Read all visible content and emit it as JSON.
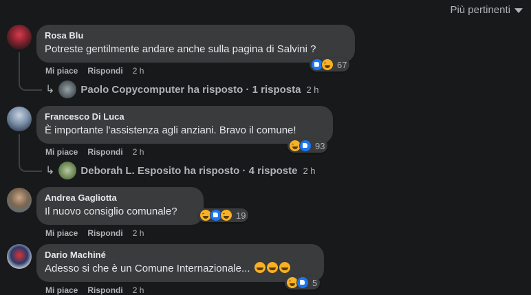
{
  "sort_label": "Più pertinenti",
  "comments": [
    {
      "author": "Rosa Blu",
      "text": "Potreste gentilmente andare anche sulla pagina di Salvini ?",
      "reaction_count": "67",
      "like": "Mi piace",
      "reply": "Rispondi",
      "time": "2 h",
      "replies": {
        "label": "Paolo Copycomputer ha risposto · 1 risposta",
        "time": "2 h"
      }
    },
    {
      "author": "Francesco Di Luca",
      "text": "È importante l'assistenza agli anziani. Bravo il comune!",
      "reaction_count": "93",
      "like": "Mi piace",
      "reply": "Rispondi",
      "time": "2 h",
      "replies": {
        "label": "Deborah L. Esposito ha risposto · 4 risposte",
        "time": "2 h"
      }
    },
    {
      "author": "Andrea Gagliotta",
      "text": "Il nuovo consiglio comunale?",
      "reaction_count": "19",
      "like": "Mi piace",
      "reply": "Rispondi",
      "time": "2 h"
    },
    {
      "author": "Dario Machiné",
      "text": "Adesso si che è un Comune Internazionale...",
      "reaction_count": "5",
      "like": "Mi piace",
      "reply": "Rispondi",
      "time": "2 h"
    }
  ]
}
